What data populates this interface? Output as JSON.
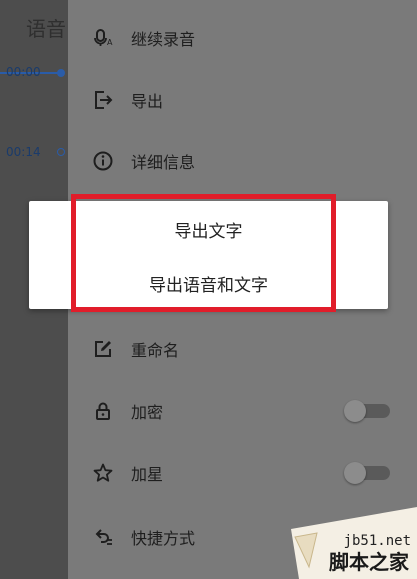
{
  "background": {
    "title": "语音",
    "time_1": "00:00",
    "time_2": "00:14"
  },
  "menu": {
    "items": [
      {
        "label": "继续录音",
        "icon": "mic-icon"
      },
      {
        "label": "导出",
        "icon": "export-icon"
      },
      {
        "label": "详细信息",
        "icon": "info-icon"
      },
      {
        "label": "重命名",
        "icon": "edit-icon"
      },
      {
        "label": "加密",
        "icon": "lock-icon",
        "toggle": false
      },
      {
        "label": "加星",
        "icon": "star-icon",
        "toggle": false
      },
      {
        "label": "快捷方式",
        "icon": "shortcut-icon"
      }
    ]
  },
  "dialog": {
    "options": [
      "导出文字",
      "导出语音和文字"
    ]
  },
  "watermark": {
    "domain": "jb51.net",
    "name": "脚本之家"
  },
  "colors": {
    "highlight": "#e11d2a",
    "accent": "#2a5ca8"
  }
}
